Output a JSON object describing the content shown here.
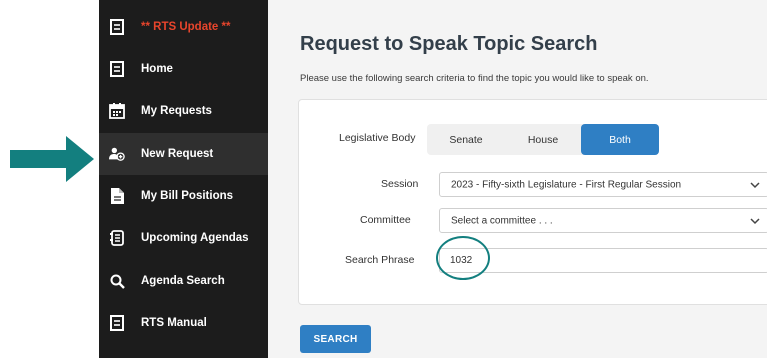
{
  "sidebar": {
    "items": [
      {
        "label": "** RTS Update **",
        "icon": "document-icon"
      },
      {
        "label": "Home",
        "icon": "document-icon"
      },
      {
        "label": "My Requests",
        "icon": "calendar-icon"
      },
      {
        "label": "New Request",
        "icon": "add-person-icon"
      },
      {
        "label": "My Bill Positions",
        "icon": "file-icon"
      },
      {
        "label": "Upcoming Agendas",
        "icon": "agenda-icon"
      },
      {
        "label": "Agenda Search",
        "icon": "search-icon"
      },
      {
        "label": "RTS Manual",
        "icon": "document-icon"
      }
    ]
  },
  "page": {
    "title": "Request to Speak Topic Search",
    "subtitle": "Please use the following search criteria to find the topic you would like to speak on."
  },
  "form": {
    "legislative_body_label": "Legislative Body",
    "body_options": [
      "Senate",
      "House",
      "Both"
    ],
    "body_selected": "Both",
    "session_label": "Session",
    "session_value": "2023 - Fifty-sixth Legislature - First Regular Session",
    "committee_label": "Committee",
    "committee_value": "Select a committee . . .",
    "search_phrase_label": "Search Phrase",
    "search_phrase_value": "1032",
    "search_button": "SEARCH"
  },
  "colors": {
    "accent": "#2f7fc4",
    "annotation": "#137f7f",
    "active_marker": "#7cb342",
    "update_text": "#e8452c"
  }
}
